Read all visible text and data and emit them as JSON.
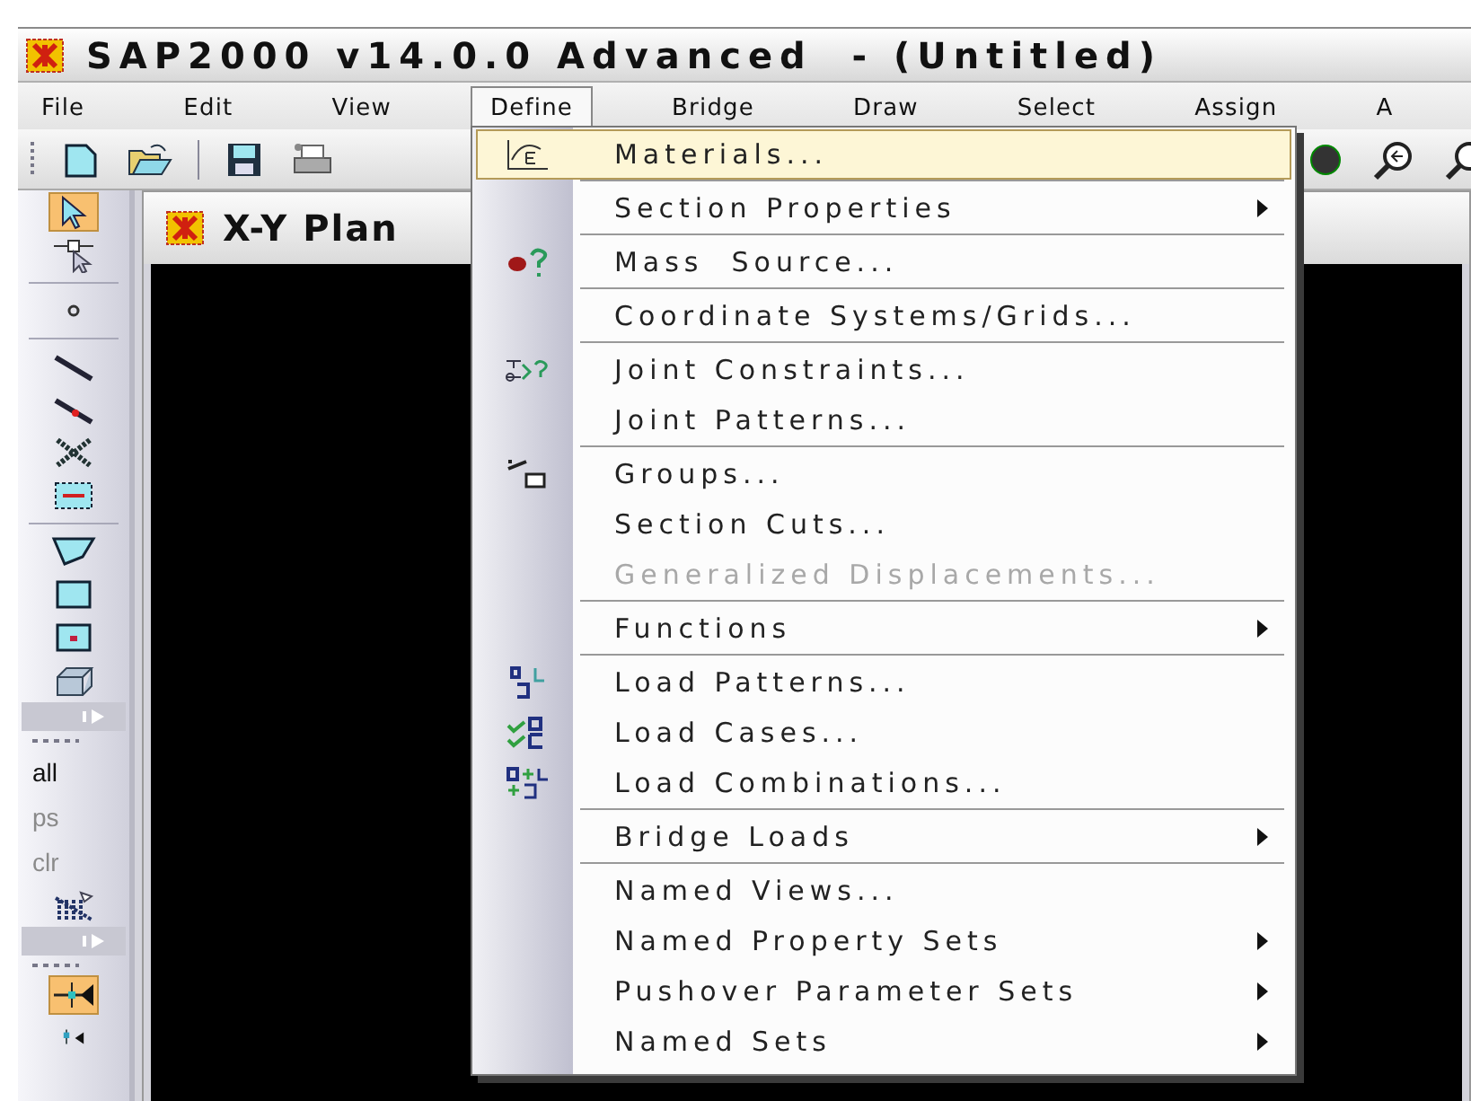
{
  "window": {
    "title": "SAP2000 v14.0.0 Advanced  - (Untitled)"
  },
  "menu_bar": [
    {
      "label": "File",
      "selected": false
    },
    {
      "label": "Edit",
      "selected": false
    },
    {
      "label": "View",
      "selected": false
    },
    {
      "label": "Define",
      "selected": true
    },
    {
      "label": "Bridge",
      "selected": false
    },
    {
      "label": "Draw",
      "selected": false
    },
    {
      "label": "Select",
      "selected": false
    },
    {
      "label": "Assign",
      "selected": false
    },
    {
      "label": "A",
      "selected": false
    }
  ],
  "left_toolbar": {
    "tools": [
      {
        "kind": "pointer",
        "selected": true
      },
      {
        "kind": "joint-pointer",
        "selected": false
      },
      {
        "kind": "separator"
      },
      {
        "kind": "joint",
        "selected": false
      },
      {
        "kind": "separator"
      },
      {
        "kind": "frame",
        "selected": false
      },
      {
        "kind": "frame-split",
        "selected": false
      },
      {
        "kind": "cross",
        "selected": false
      },
      {
        "kind": "section-cut",
        "selected": false
      },
      {
        "kind": "separator"
      },
      {
        "kind": "polygon",
        "selected": false
      },
      {
        "kind": "rectangle",
        "selected": false
      },
      {
        "kind": "rectangle-point",
        "selected": false
      },
      {
        "kind": "solid",
        "selected": false
      },
      {
        "kind": "overflow"
      },
      {
        "kind": "grip"
      },
      {
        "kind": "text",
        "label": "all",
        "disabled": false
      },
      {
        "kind": "text",
        "label": "ps",
        "disabled": true
      },
      {
        "kind": "text",
        "label": "clr",
        "disabled": true
      },
      {
        "kind": "lines-select",
        "selected": false
      },
      {
        "kind": "overflow"
      },
      {
        "kind": "grip"
      },
      {
        "kind": "snap",
        "selected": true
      },
      {
        "kind": "snap-small",
        "selected": false
      }
    ]
  },
  "view_window": {
    "title": "X-Y Plan"
  },
  "define_menu": {
    "items": [
      {
        "kind": "item",
        "label": "Materials...",
        "highlighted": true,
        "disabled": false,
        "submenu": false
      },
      {
        "kind": "separator"
      },
      {
        "kind": "item",
        "label": "Section Properties",
        "highlighted": false,
        "disabled": false,
        "submenu": true
      },
      {
        "kind": "separator"
      },
      {
        "kind": "item",
        "label": "Mass  Source...",
        "highlighted": false,
        "disabled": false,
        "submenu": false
      },
      {
        "kind": "separator"
      },
      {
        "kind": "item",
        "label": "Coordinate Systems/Grids...",
        "highlighted": false,
        "disabled": false,
        "submenu": false
      },
      {
        "kind": "separator"
      },
      {
        "kind": "item",
        "label": "Joint Constraints...",
        "highlighted": false,
        "disabled": false,
        "submenu": false
      },
      {
        "kind": "item",
        "label": "Joint Patterns...",
        "highlighted": false,
        "disabled": false,
        "submenu": false
      },
      {
        "kind": "separator"
      },
      {
        "kind": "item",
        "label": "Groups...",
        "highlighted": false,
        "disabled": false,
        "submenu": false
      },
      {
        "kind": "item",
        "label": "Section Cuts...",
        "highlighted": false,
        "disabled": false,
        "submenu": false
      },
      {
        "kind": "item",
        "label": "Generalized Displacements...",
        "highlighted": false,
        "disabled": true,
        "submenu": false
      },
      {
        "kind": "separator"
      },
      {
        "kind": "item",
        "label": "Functions",
        "highlighted": false,
        "disabled": false,
        "submenu": true
      },
      {
        "kind": "separator"
      },
      {
        "kind": "item",
        "label": "Load Patterns...",
        "highlighted": false,
        "disabled": false,
        "submenu": false
      },
      {
        "kind": "item",
        "label": "Load Cases...",
        "highlighted": false,
        "disabled": false,
        "submenu": false
      },
      {
        "kind": "item",
        "label": "Load Combinations...",
        "highlighted": false,
        "disabled": false,
        "submenu": false
      },
      {
        "kind": "separator"
      },
      {
        "kind": "item",
        "label": "Bridge Loads",
        "highlighted": false,
        "disabled": false,
        "submenu": true
      },
      {
        "kind": "separator"
      },
      {
        "kind": "item",
        "label": "Named Views...",
        "highlighted": false,
        "disabled": false,
        "submenu": false
      },
      {
        "kind": "item",
        "label": "Named Property Sets",
        "highlighted": false,
        "disabled": false,
        "submenu": true
      },
      {
        "kind": "item",
        "label": "Pushover Parameter Sets",
        "highlighted": false,
        "disabled": false,
        "submenu": true
      },
      {
        "kind": "item",
        "label": "Named Sets",
        "highlighted": false,
        "disabled": false,
        "submenu": true
      }
    ]
  }
}
